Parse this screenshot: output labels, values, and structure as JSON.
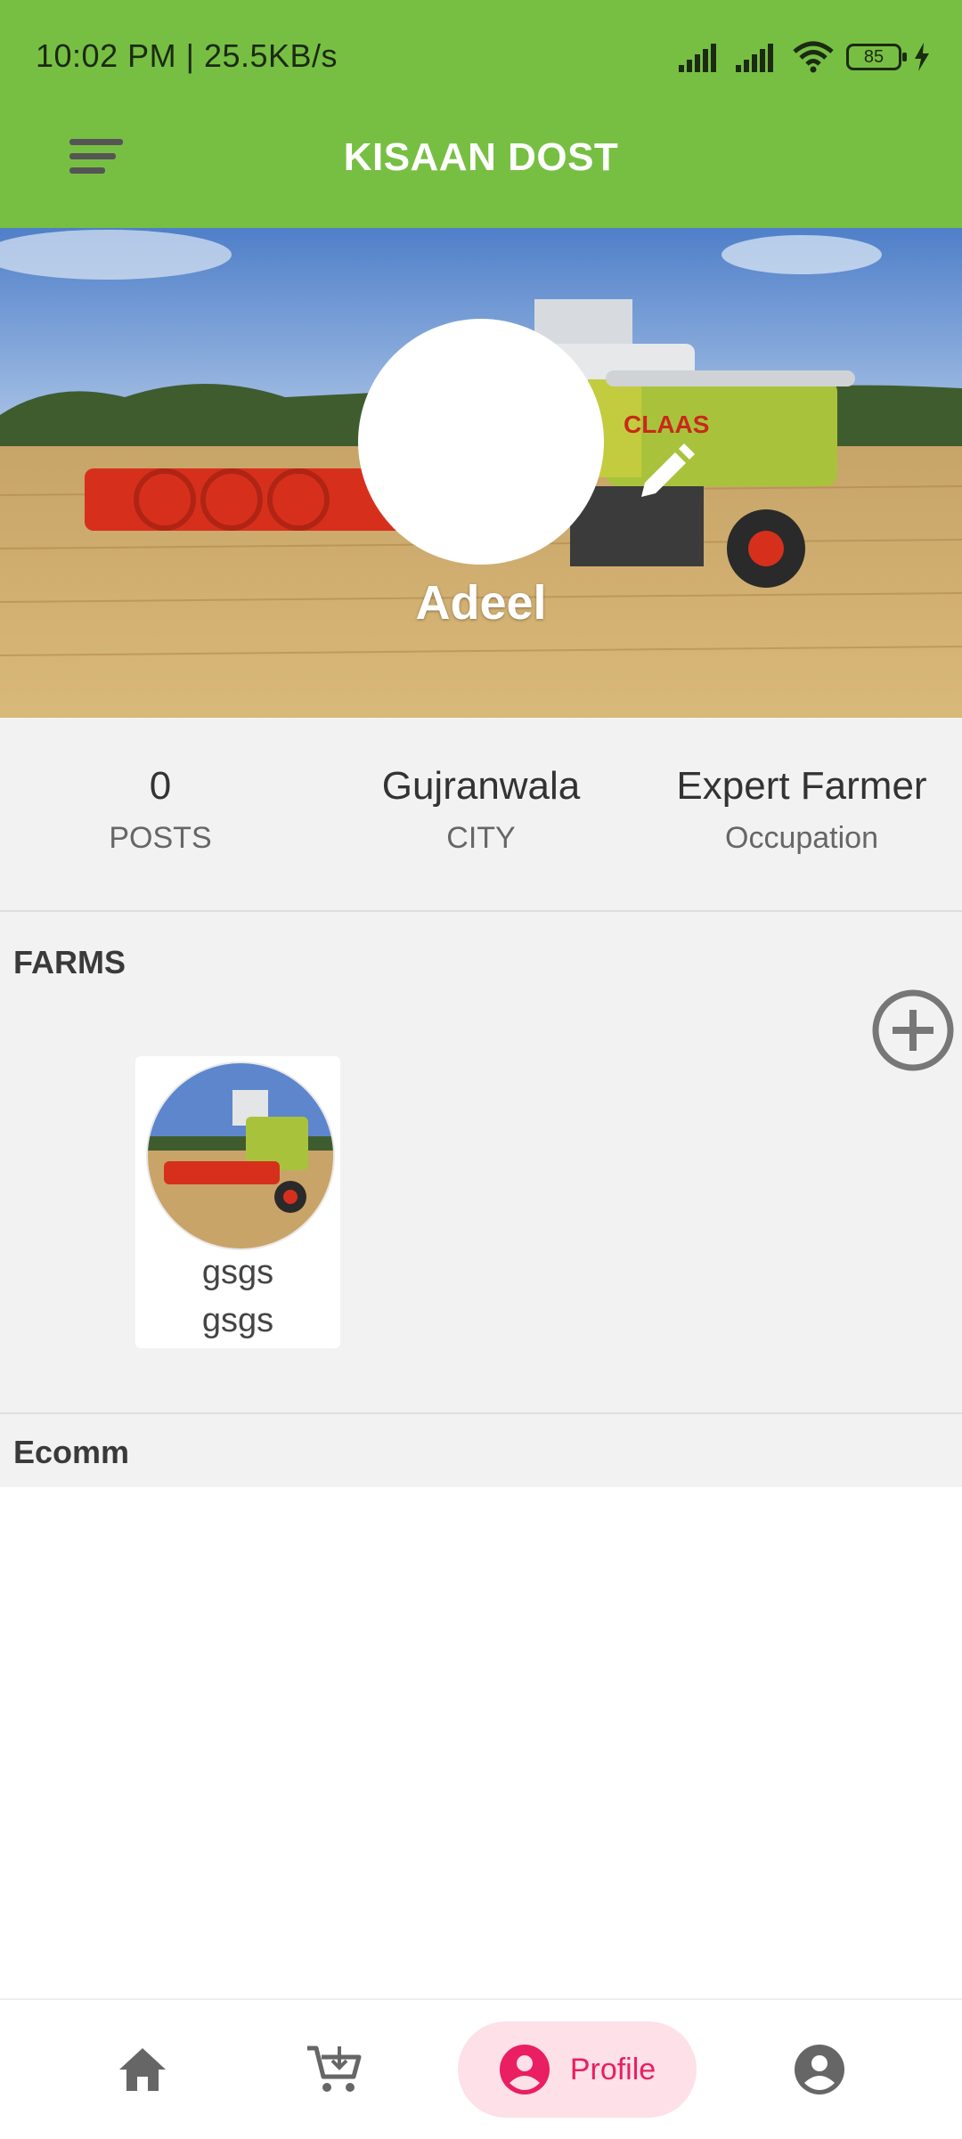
{
  "status_bar": {
    "time_speed": "10:02 PM | 25.5KB/s",
    "battery": "85"
  },
  "app_bar": {
    "title": "KISAAN DOST",
    "menu_icon": "menu-sort-icon"
  },
  "profile": {
    "name": "Adeel",
    "edit_icon": "pencil-icon"
  },
  "stats": [
    {
      "value": "0",
      "label": "POSTS"
    },
    {
      "value": "Gujranwala",
      "label": "CITY"
    },
    {
      "value": "Expert Farmer",
      "label": "Occupation"
    }
  ],
  "farms": {
    "title": "FARMS",
    "add_icon": "add-circle-icon",
    "items": [
      {
        "line1": "gsgs",
        "line2": "gsgs"
      }
    ]
  },
  "ecomm": {
    "title": "Ecomm"
  },
  "bottom_nav": {
    "items": [
      {
        "icon": "home-icon"
      },
      {
        "icon": "cart-icon"
      },
      {
        "icon": "profile-icon",
        "label": "Profile",
        "active": true
      },
      {
        "icon": "account-icon"
      }
    ],
    "active_color": "#e91e63",
    "active_bg": "#fde0e8"
  },
  "colors": {
    "brand_green": "#77bf43"
  }
}
